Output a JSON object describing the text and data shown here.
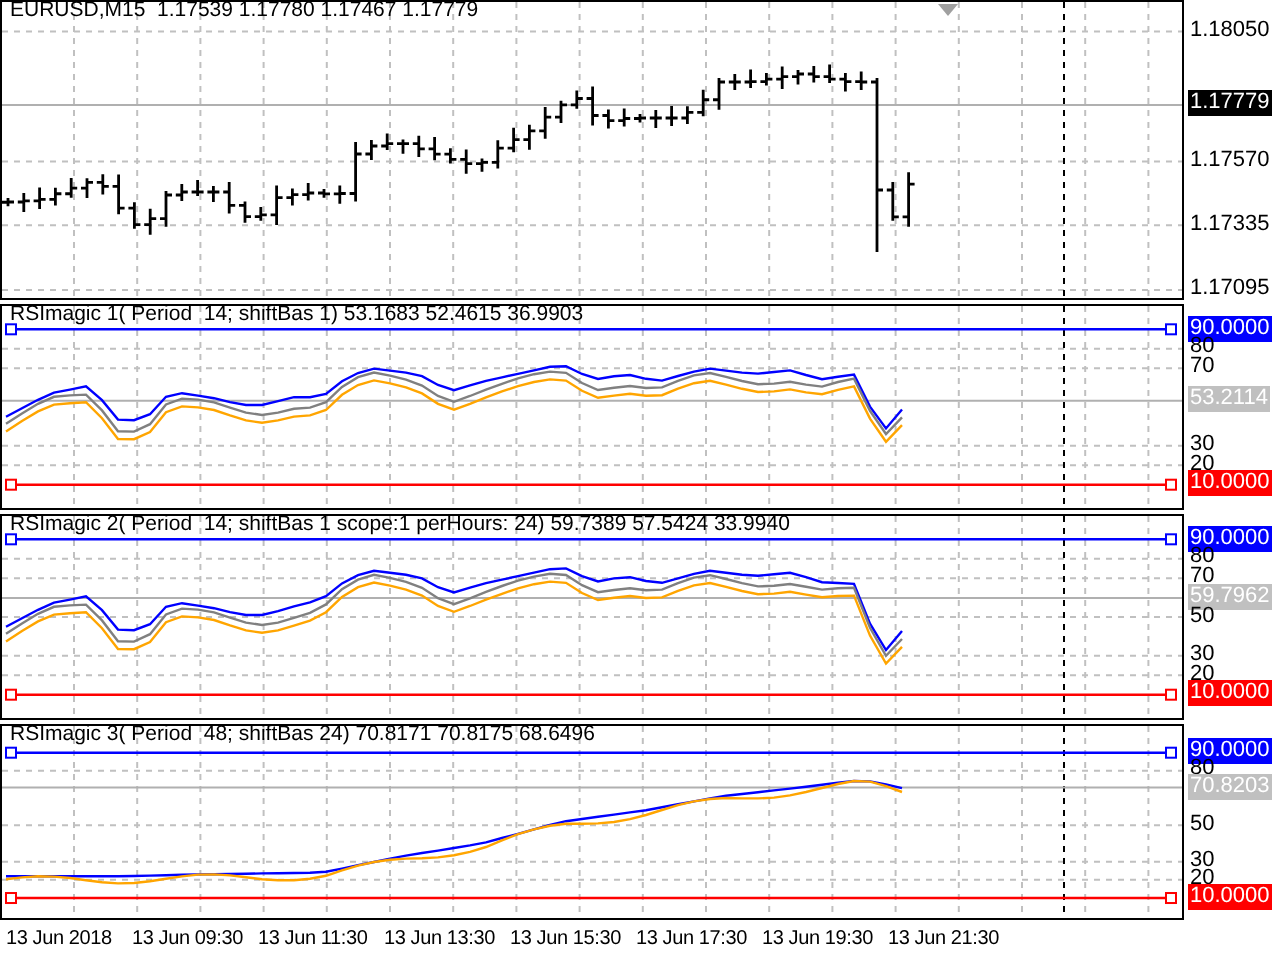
{
  "chart": {
    "panes": [
      {
        "kind": "price",
        "title": "EURUSD,M15  1.17539 1.17780 1.17467 1.17779",
        "axis_labels": [
          {
            "text": "1.18050",
            "kind": "tick"
          },
          {
            "text": "1.17779",
            "kind": "current"
          },
          {
            "text": "1.17570",
            "kind": "tick"
          },
          {
            "text": "1.17335",
            "kind": "tick"
          },
          {
            "text": "1.17095",
            "kind": "tick"
          }
        ]
      },
      {
        "kind": "indicator",
        "title": "RSImagic 1( Period  14; shiftBas 1) 53.1683 52.4615 36.9903",
        "axis_labels": [
          {
            "text": "90.0000",
            "kind": "level_high"
          },
          {
            "text": "80",
            "kind": "tick"
          },
          {
            "text": "70",
            "kind": "tick"
          },
          {
            "text": "53.2114",
            "kind": "value"
          },
          {
            "text": "30",
            "kind": "tick"
          },
          {
            "text": "20",
            "kind": "tick"
          },
          {
            "text": "10.0000",
            "kind": "level_low"
          }
        ]
      },
      {
        "kind": "indicator",
        "title": "RSImagic 2( Period  14; shiftBas 1 scope:1 perHours: 24) 59.7389 57.5424 33.9940",
        "axis_labels": [
          {
            "text": "90.0000",
            "kind": "level_high"
          },
          {
            "text": "80",
            "kind": "tick"
          },
          {
            "text": "70",
            "kind": "tick"
          },
          {
            "text": "59.7962",
            "kind": "value"
          },
          {
            "text": "50",
            "kind": "tick"
          },
          {
            "text": "30",
            "kind": "tick"
          },
          {
            "text": "20",
            "kind": "tick"
          },
          {
            "text": "10.0000",
            "kind": "level_low"
          }
        ]
      },
      {
        "kind": "indicator",
        "title": "RSImagic 3( Period  48; shiftBas 24) 70.8171 70.8175 68.6496",
        "axis_labels": [
          {
            "text": "90.0000",
            "kind": "level_high"
          },
          {
            "text": "80",
            "kind": "tick"
          },
          {
            "text": "70.8203",
            "kind": "value"
          },
          {
            "text": "50",
            "kind": "tick"
          },
          {
            "text": "30",
            "kind": "tick"
          },
          {
            "text": "20",
            "kind": "tick"
          },
          {
            "text": "10.0000",
            "kind": "level_low"
          }
        ]
      }
    ],
    "time_labels": [
      "13 Jun 2018",
      "13 Jun 09:30",
      "13 Jun 11:30",
      "13 Jun 13:30",
      "13 Jun 15:30",
      "13 Jun 17:30",
      "13 Jun 19:30",
      "13 Jun 21:30"
    ]
  }
}
